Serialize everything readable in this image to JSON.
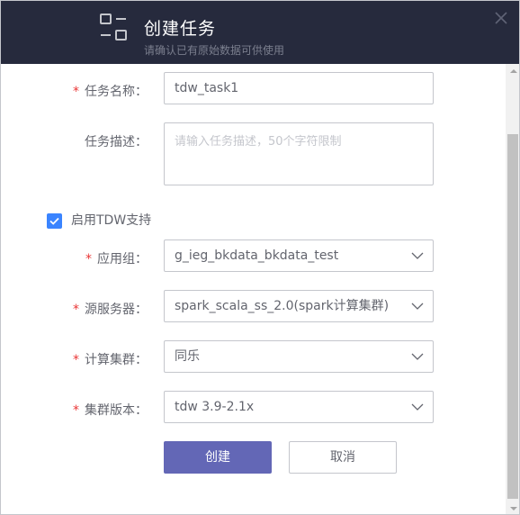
{
  "header": {
    "title": "创建任务",
    "subtitle": "请确认已有原始数据可供使用"
  },
  "form": {
    "task_name": {
      "label": "任务名称：",
      "required": true,
      "value": "tdw_task1"
    },
    "task_desc": {
      "label": "任务描述：",
      "required": false,
      "placeholder": "请输入任务描述，50个字符限制"
    },
    "enable_tdw": {
      "label": "启用TDW支持",
      "checked": true
    },
    "app_group": {
      "label": "应用组：",
      "required": true,
      "value": "g_ieg_bkdata_bkdata_test"
    },
    "source_server": {
      "label": "源服务器：",
      "required": true,
      "value": "spark_scala_ss_2.0(spark计算集群)"
    },
    "compute_cluster": {
      "label": "计算集群：",
      "required": true,
      "value": "同乐"
    },
    "cluster_version": {
      "label": "集群版本：",
      "required": true,
      "value": "tdw 3.9-2.1x"
    }
  },
  "buttons": {
    "create": "创建",
    "cancel": "取消"
  },
  "required_mark": "*",
  "colors": {
    "header_bg": "#262a3d",
    "primary": "#6367b6",
    "checkbox": "#3a84ff",
    "required": "#ea3636"
  }
}
